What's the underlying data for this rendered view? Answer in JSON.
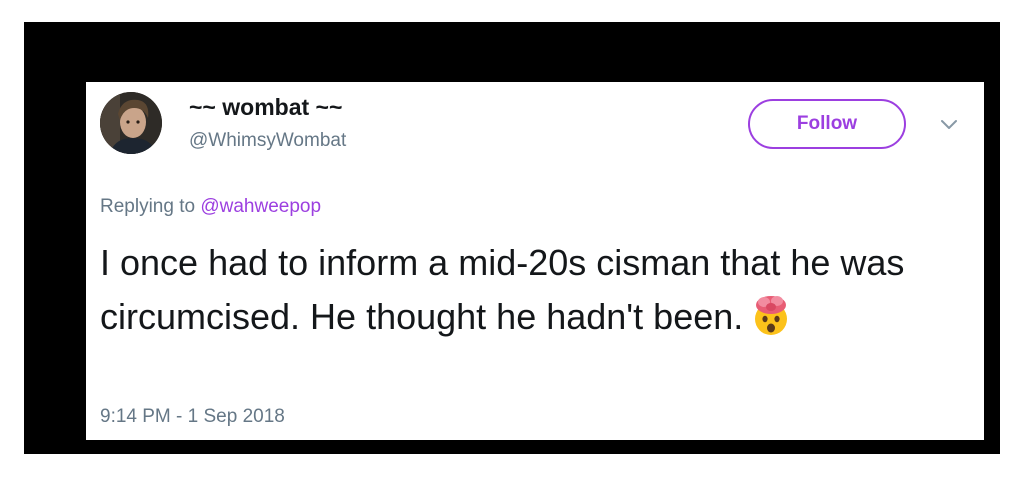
{
  "tweet": {
    "display_name": "~~ wombat ~~",
    "handle": "@WhimsyWombat",
    "follow_label": "Follow",
    "replying_prefix": "Replying to",
    "replying_to": "@wahweepop",
    "text": "I once had to inform a mid-20s cisman that he was circumcised. He thought he hadn't been.",
    "emoji": "exploding-head",
    "timestamp": "9:14 PM - 1 Sep 2018"
  },
  "colors": {
    "accent": "#9c3fe0",
    "text": "#14171a",
    "muted": "#657786",
    "frame": "#000000"
  },
  "icons": [
    "avatar-photo",
    "chevron-down-icon",
    "exploding-head-emoji"
  ]
}
